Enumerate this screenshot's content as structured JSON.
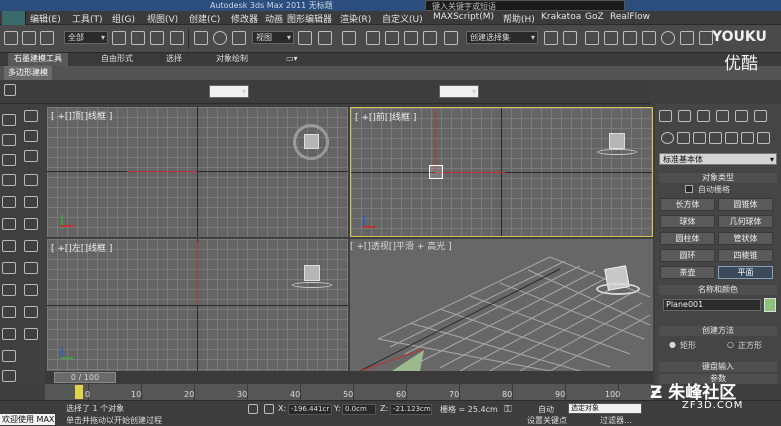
{
  "titlebar": {
    "app_title": "Autodesk 3ds Max 2011   无标题",
    "search_placeholder": "键入关键字或短语"
  },
  "menu": [
    "编辑(E)",
    "工具(T)",
    "组(G)",
    "视图(V)",
    "创建(C)",
    "修改器",
    "动画",
    "图形编辑器",
    "渲染(R)",
    "自定义(U)",
    "MAXScript(M)",
    "帮助(H)",
    "Krakatoa",
    "GoZ",
    "RealFlow"
  ],
  "toolbar": {
    "selection_filter": "全部",
    "ref_coord": "视图",
    "named_selection": "创建选择集"
  },
  "ribbon": {
    "tabs": [
      "石墨建模工具",
      "自由形式",
      "选择",
      "对象绘制"
    ],
    "sub_label": "多边形建模"
  },
  "viewports": [
    {
      "label": "[ +[]顶[]线框 ]"
    },
    {
      "label": "[ +[]前[]线框 ]"
    },
    {
      "label": "[ +[]左[]线框 ]"
    },
    {
      "label": "[ +[]透视[]平滑 + 高光 ]"
    }
  ],
  "command_panel": {
    "category": "标准基本体",
    "object_type_title": "对象类型",
    "autogrid_label": "自动栅格",
    "primitives": [
      "长方体",
      "圆锥体",
      "球体",
      "几何球体",
      "圆柱体",
      "管状体",
      "圆环",
      "四棱锥",
      "茶壶",
      "平面"
    ],
    "active_primitive": "平面",
    "name_color_title": "名称和颜色",
    "object_name": "Plane001",
    "object_color": "#8cc27a",
    "creation_method_title": "创建方法",
    "creation_methods": [
      "矩形",
      "正方形"
    ],
    "keyboard_entry_title": "键盘输入",
    "params_title": "参数"
  },
  "timeline": {
    "frame_display": "0 / 100",
    "ticks": [
      "0",
      "10",
      "20",
      "30",
      "40",
      "50",
      "60",
      "70",
      "80",
      "90",
      "100"
    ]
  },
  "status": {
    "welcome": "欢迎使用 MAX",
    "selected_text": "选择了 1 个对象",
    "hint_text": "单击并拖动以开始创建过程",
    "x_label": "X:",
    "x_value": "-196.441cr",
    "y_label": "Y:",
    "y_value": "0.0cm",
    "z_label": "Z:",
    "z_value": "-21.123cm",
    "grid_label": "栅格 = 25.4cm",
    "auto_key": "自动",
    "key_filter_select": "选定对象",
    "set_key": "设置关键点",
    "key_filter": "过滤器..."
  },
  "watermarks": {
    "youku_en": "YOUKU",
    "youku_cn": "优酷",
    "zf3d_cn": "朱峰社区",
    "zf3d_url": "ZF3D.COM"
  }
}
